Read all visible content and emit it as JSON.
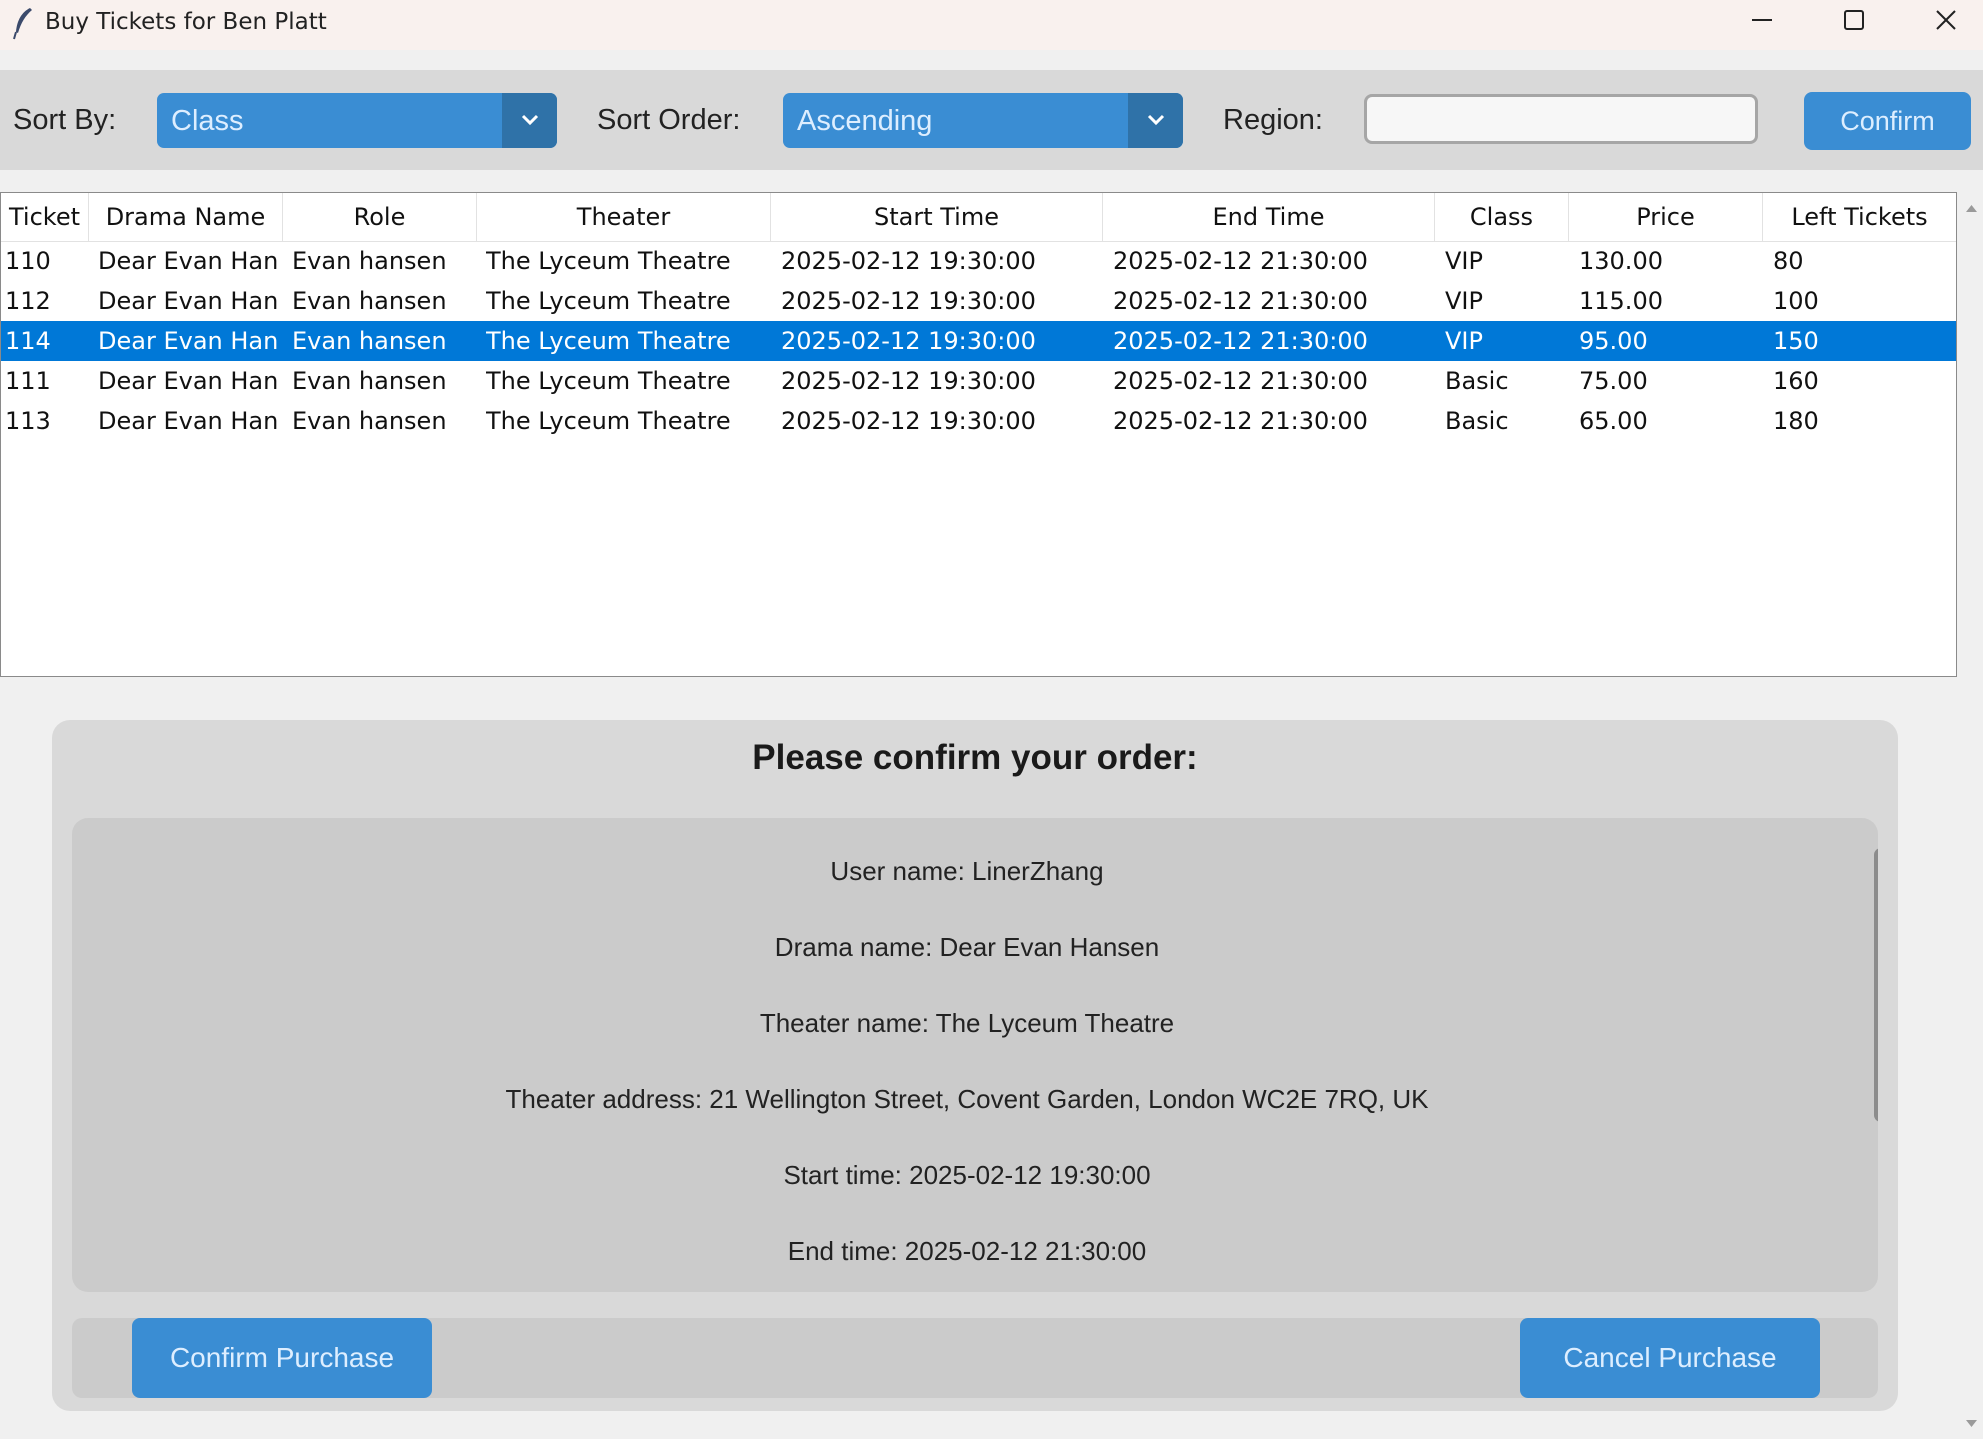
{
  "window": {
    "title": "Buy Tickets for Ben Platt"
  },
  "toolbar": {
    "sort_by_label": "Sort By:",
    "sort_by_value": "Class",
    "sort_order_label": "Sort Order:",
    "sort_order_value": "Ascending",
    "region_label": "Region:",
    "region_value": "",
    "confirm_label": "Confirm"
  },
  "table": {
    "columns": [
      "Ticket",
      "Drama Name",
      "Role",
      "Theater",
      "Start Time",
      "End Time",
      "Class",
      "Price",
      "Left Tickets"
    ],
    "rows": [
      {
        "ticket": "110",
        "drama": "Dear Evan Hansen",
        "role": "Evan hansen",
        "theater": "The Lyceum Theatre",
        "start": "2025-02-12 19:30:00",
        "end": "2025-02-12 21:30:00",
        "class": "VIP",
        "price": "130.00",
        "left": "80",
        "selected": false
      },
      {
        "ticket": "112",
        "drama": "Dear Evan Hansen",
        "role": "Evan hansen",
        "theater": "The Lyceum Theatre",
        "start": "2025-02-12 19:30:00",
        "end": "2025-02-12 21:30:00",
        "class": "VIP",
        "price": "115.00",
        "left": "100",
        "selected": false
      },
      {
        "ticket": "114",
        "drama": "Dear Evan Hansen",
        "role": "Evan hansen",
        "theater": "The Lyceum Theatre",
        "start": "2025-02-12 19:30:00",
        "end": "2025-02-12 21:30:00",
        "class": "VIP",
        "price": "95.00",
        "left": "150",
        "selected": true
      },
      {
        "ticket": "111",
        "drama": "Dear Evan Hansen",
        "role": "Evan hansen",
        "theater": "The Lyceum Theatre",
        "start": "2025-02-12 19:30:00",
        "end": "2025-02-12 21:30:00",
        "class": "Basic",
        "price": "75.00",
        "left": "160",
        "selected": false
      },
      {
        "ticket": "113",
        "drama": "Dear Evan Hansen",
        "role": "Evan hansen",
        "theater": "The Lyceum Theatre",
        "start": "2025-02-12 19:30:00",
        "end": "2025-02-12 21:30:00",
        "class": "Basic",
        "price": "65.00",
        "left": "180",
        "selected": false
      }
    ]
  },
  "order": {
    "heading": "Please confirm your order:",
    "lines": [
      "User name: LinerZhang",
      "Drama name: Dear Evan Hansen",
      "Theater name: The Lyceum Theatre",
      "Theater address: 21 Wellington Street, Covent Garden, London WC2E 7RQ, UK",
      "Start time: 2025-02-12 19:30:00",
      "End time: 2025-02-12 21:30:00"
    ],
    "confirm_button": "Confirm Purchase",
    "cancel_button": "Cancel Purchase"
  }
}
